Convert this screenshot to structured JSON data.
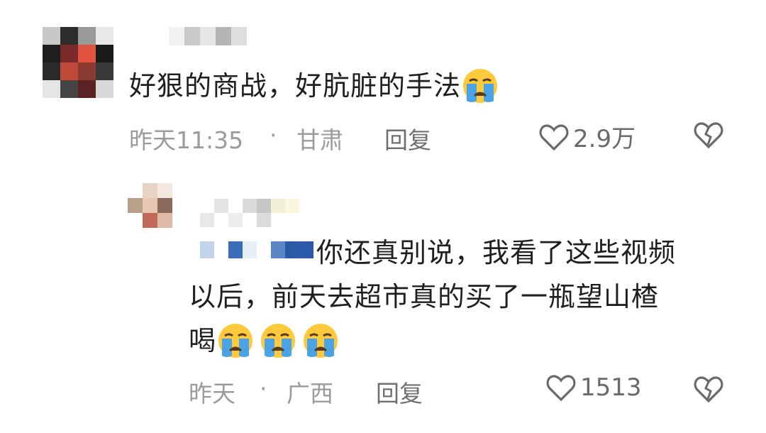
{
  "comments": [
    {
      "text": "好狠的商战，好肮脏的手法",
      "emoji_count": 1,
      "time": "昨天11:35",
      "separator": "·",
      "location": "甘肃",
      "reply_label": "回复",
      "likes": "2.9万"
    }
  ],
  "replies": [
    {
      "text_line1": "你还真别说，我看了这些视频",
      "text_line2": "以后，前天去超市真的买了一瓶望山楂",
      "text_line3": "喝",
      "emoji_count": 3,
      "time": "昨天",
      "separator": "·",
      "location": "广西",
      "reply_label": "回复",
      "likes": "1513"
    }
  ],
  "icons": {
    "emoji": "crying-face-icon",
    "like": "heart-outline-icon",
    "dislike": "broken-heart-icon"
  },
  "colors": {
    "text": "#1f1f1f",
    "meta": "#9b9b9b",
    "reply": "#6f6f6f",
    "mention_blue": "#3a6fb8"
  }
}
